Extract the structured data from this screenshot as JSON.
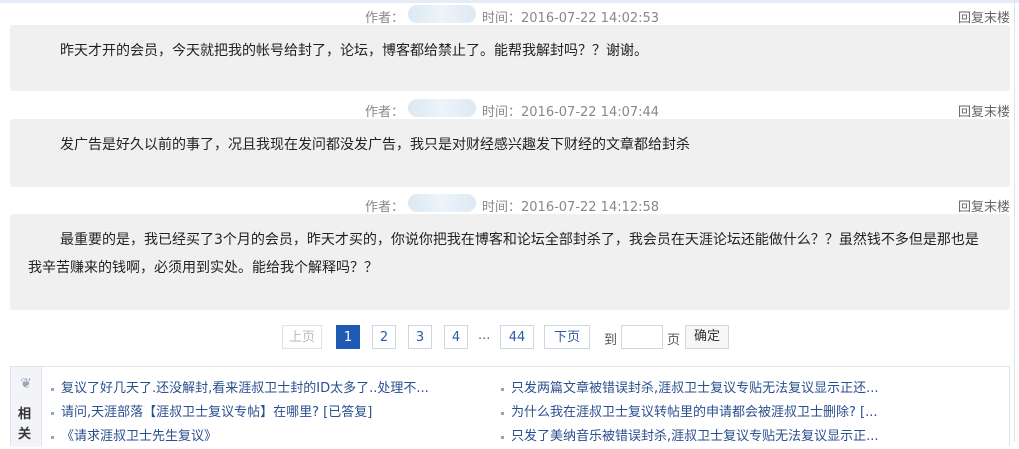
{
  "posts": [
    {
      "author_label": "作者：",
      "time": "时间：2016-07-22 14:02:53",
      "reply": "回复末楼",
      "paragraphs": [
        "昨天才开的会员，今天就把我的帐号给封了，论坛，博客都给禁止了。能帮我解封吗？？谢谢。"
      ]
    },
    {
      "author_label": "作者：",
      "time": "时间：2016-07-22 14:07:44",
      "reply": "回复末楼",
      "paragraphs": [
        "发广告是好久以前的事了，况且我现在发问都没发广告，我只是对财经感兴趣发下财经的文章都给封杀"
      ]
    },
    {
      "author_label": "作者：",
      "time": "时间：2016-07-22 14:12:58",
      "reply": "回复末楼",
      "paragraphs": [
        "最重要的是，我已经买了3个月的会员，昨天才买的，你说你把我在博客和论坛全部封杀了，我会员在天涯论坛还能做什么？？虽然钱不多但是那也是我辛苦赚来的钱啊，必须用到实处。能给我个解释吗？？"
      ]
    }
  ],
  "pager": {
    "prev": "上页",
    "pages": [
      "1",
      "2",
      "3",
      "4"
    ],
    "dots": "...",
    "last": "44",
    "next": "下页",
    "goto_label": "到",
    "page_label": "页",
    "goto_value": "",
    "confirm": "确定"
  },
  "related": {
    "title_chars": [
      "相",
      "关"
    ],
    "left": [
      "复议了好几天了.还没解封,看来涯叔卫士封的ID太多了..处理不...",
      "请问,天涯部落【涯叔卫士复议专帖】在哪里? [已答复]",
      "《请求涯叔卫士先生复议》"
    ],
    "right": [
      "只发两篇文章被错误封杀,涯叔卫士复议专贴无法复议显示正还...",
      "为什么我在涯叔卫士复议转帖里的申请都会被涯叔卫士删除? [...",
      "只发了美纳音乐被错误封杀,涯叔卫士复议专贴无法复议显示正..."
    ]
  }
}
